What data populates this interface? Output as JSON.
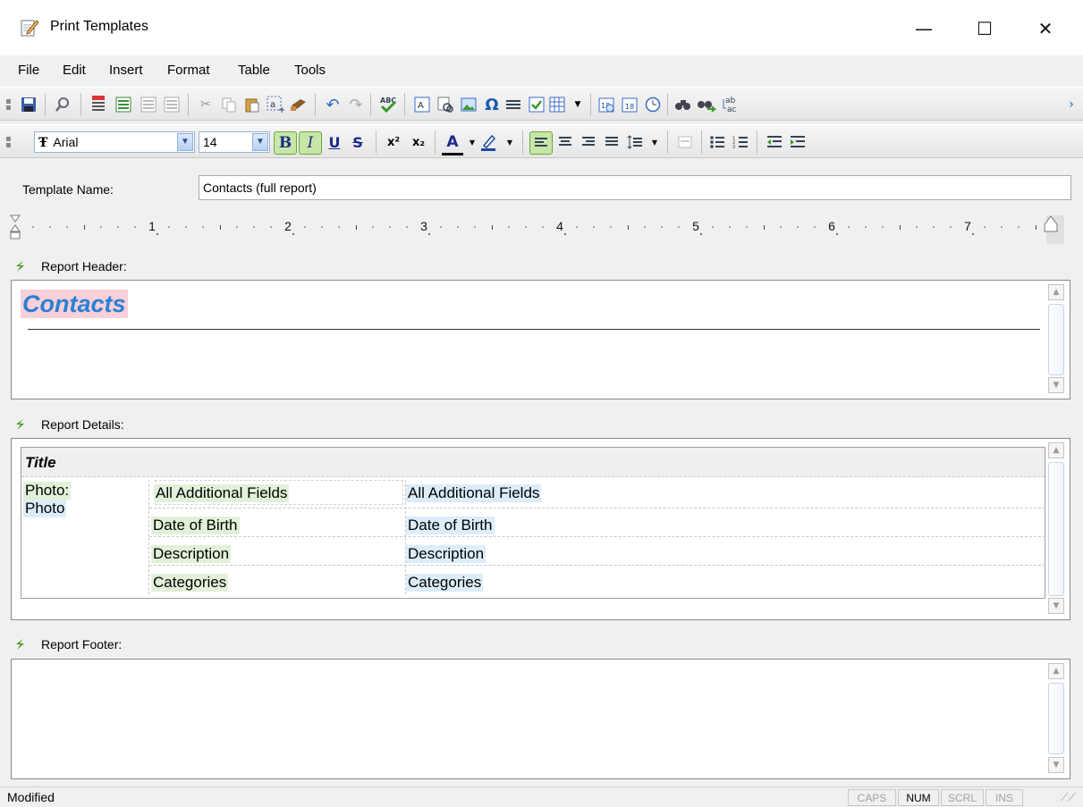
{
  "window": {
    "title": "Print Templates",
    "minimize_glyph": "—",
    "maximize_glyph": "☐",
    "close_glyph": "✕"
  },
  "menu": [
    "File",
    "Edit",
    "Insert",
    "Format",
    "Table",
    "Tools"
  ],
  "format_toolbar": {
    "font_name": "Arial",
    "font_size": "14",
    "bold": "B",
    "italic": "I",
    "underline": "U",
    "strike": "S",
    "superscript": "x²",
    "subscript": "x₂",
    "font_color_letter": "A"
  },
  "template_name": {
    "label": "Template Name:",
    "value": "Contacts (full report)"
  },
  "ruler": {
    "numbers": [
      "1",
      "2",
      "3",
      "4",
      "5",
      "6",
      "7"
    ]
  },
  "sections": {
    "header": {
      "label": "Report Header:",
      "content_title": "Contacts"
    },
    "details": {
      "label": "Report Details:",
      "title_field": "Title",
      "photo_label": "Photo:",
      "photo_field": "Photo",
      "rows": [
        {
          "label": "All Additional Fields",
          "value": "All Additional Fields"
        },
        {
          "label": "Date of Birth",
          "value": "Date of Birth"
        },
        {
          "label": "Description",
          "value": "Description"
        },
        {
          "label": "Categories",
          "value": "Categories"
        }
      ]
    },
    "footer": {
      "label": "Report Footer:"
    }
  },
  "status": {
    "text": "Modified",
    "indicators": [
      "CAPS",
      "NUM",
      "SCRL",
      "INS"
    ],
    "active_indicator": "NUM"
  },
  "colors": {
    "accent_title": "#2a7fd4",
    "title_highlight": "#f7d0d8",
    "field_label_bg": "#e1f1d9",
    "field_value_bg": "#dcedf9",
    "section_icon": "#3d9a1e"
  }
}
